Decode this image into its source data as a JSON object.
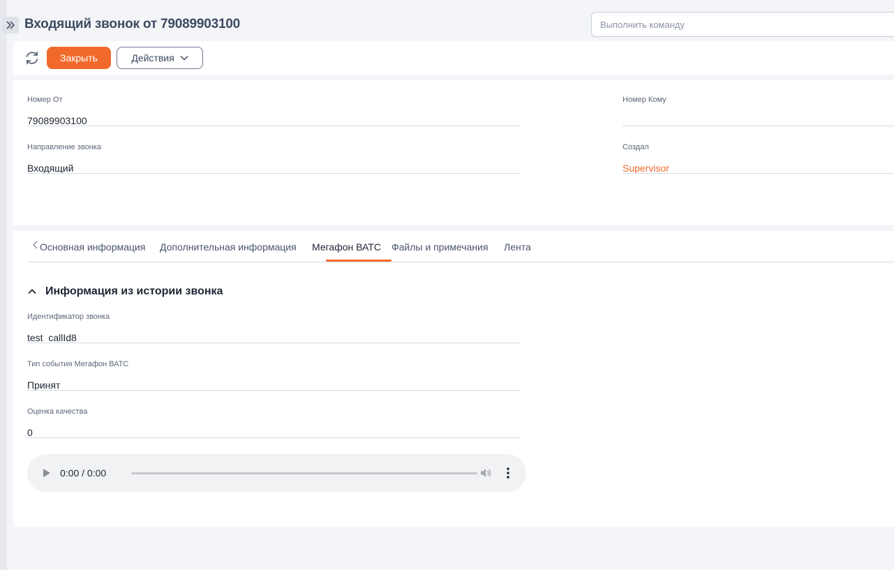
{
  "header": {
    "title": "Входящий звонок от 79089903100",
    "command_placeholder": "Выполнить команду"
  },
  "toolbar": {
    "close_label": "Закрыть",
    "actions_label": "Действия"
  },
  "details": {
    "from_number": {
      "label": "Номер От",
      "value": "79089903100"
    },
    "to_number": {
      "label": "Номер Кому",
      "value": ""
    },
    "direction": {
      "label": "Направление звонка",
      "value": "Входящий"
    },
    "created_by": {
      "label": "Создал",
      "value": "Supervisor"
    }
  },
  "tabs": [
    {
      "label": "Основная информация"
    },
    {
      "label": "Дополнительная информация"
    },
    {
      "label": "Мегафон ВАТС",
      "active": true
    },
    {
      "label": "Файлы и примечания"
    },
    {
      "label": "Лента"
    }
  ],
  "section": {
    "title": "Информация из истории звонка",
    "fields": [
      {
        "label": "Идентификатор звонка",
        "value": "test_callId8"
      },
      {
        "label": "Тип события Мегафон ВАТС",
        "value": "Принят"
      },
      {
        "label": "Оценка качества",
        "value": "0"
      }
    ]
  },
  "audio": {
    "time": "0:00 / 0:00",
    "progress": 0
  },
  "colors": {
    "accent": "#f26a2b",
    "title": "#3c4a61"
  }
}
